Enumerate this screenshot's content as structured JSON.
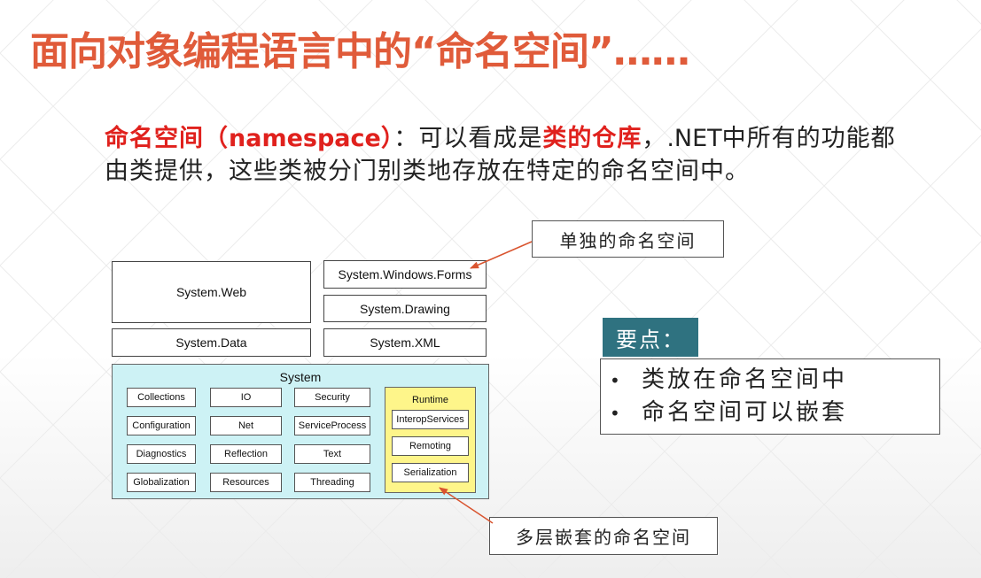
{
  "title": "面向对象编程语言中的“命名空间”……",
  "intro": {
    "term": "命名空间",
    "paren_open": "（",
    "term_en": "namespace",
    "paren_close": "）",
    "colon": "：",
    "text1": "可以看成是",
    "highlight": "类的仓库",
    "text2": "，",
    "net": ".NET",
    "text3": "中所有的功能都由类提供，这些类被分门别类地存放在特定的命名空间中。"
  },
  "diagram": {
    "top_boxes": {
      "web": "System.Web",
      "forms": "System.Windows.Forms",
      "drawing": "System.Drawing",
      "data": "System.Data",
      "xml": "System.XML"
    },
    "system": {
      "label": "System",
      "items": [
        "Collections",
        "IO",
        "Security",
        "Configuration",
        "Net",
        "ServiceProcess",
        "Diagnostics",
        "Reflection",
        "Text",
        "Globalization",
        "Resources",
        "Threading"
      ],
      "runtime": {
        "label": "Runtime",
        "items": [
          "InteropServices",
          "Remoting",
          "Serialization"
        ]
      }
    }
  },
  "callouts": {
    "single": "单独的命名空间",
    "nested": "多层嵌套的命名空间"
  },
  "keypoints": {
    "header": "要点：",
    "bullet": "•",
    "items": [
      "类放在命名空间中",
      "命名空间可以嵌套"
    ]
  },
  "colors": {
    "title": "#e05b3a",
    "highlight": "#e0211d",
    "system_bg": "#cdf2f5",
    "runtime_bg": "#fef58a",
    "keypoints_header_bg": "#2f7280",
    "arrow": "#d9542f"
  }
}
